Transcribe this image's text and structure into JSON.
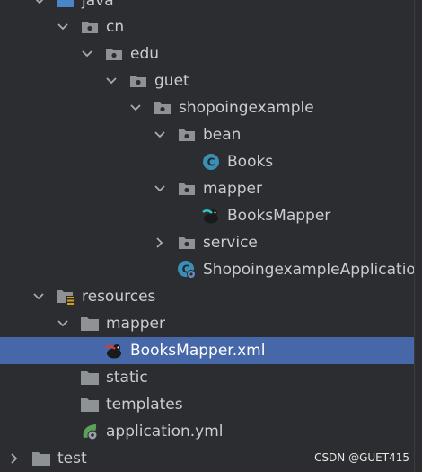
{
  "colors": {
    "background": "#2b2d30",
    "selection": "#4667a8",
    "text": "#c9ccd1",
    "folder": "#8e9196",
    "class_badge": "#3b8fb5"
  },
  "tree": {
    "java_label": "java",
    "cn_label": "cn",
    "edu_label": "edu",
    "guet_label": "guet",
    "shopoingexample_label": "shopoingexample",
    "bean_label": "bean",
    "books_label": "Books",
    "mapper_pkg_label": "mapper",
    "booksmapper_label": "BooksMapper",
    "service_label": "service",
    "app_label": "ShopoingexampleApplication",
    "resources_label": "resources",
    "res_mapper_label": "mapper",
    "booksmapper_xml_label": "BooksMapper.xml",
    "static_label": "static",
    "templates_label": "templates",
    "application_yml_label": "application.yml",
    "test_label": "test"
  },
  "watermark": "CSDN @GUET415"
}
